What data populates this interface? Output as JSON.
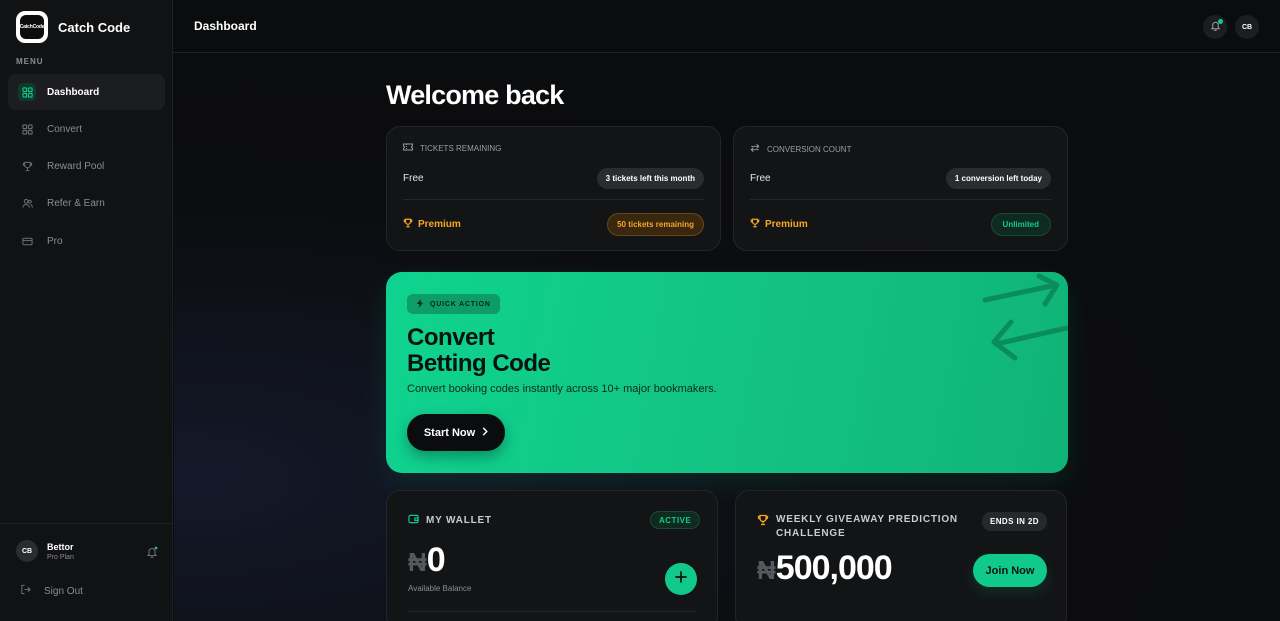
{
  "brand": {
    "name": "Catch Code",
    "logo_text": "CatchCode"
  },
  "sidebar": {
    "menu_label": "MENU",
    "items": [
      {
        "label": "Dashboard",
        "icon": "grid-icon",
        "active": true
      },
      {
        "label": "Convert",
        "icon": "grid-icon",
        "active": false
      },
      {
        "label": "Reward Pool",
        "icon": "trophy-icon",
        "active": false
      },
      {
        "label": "Refer & Earn",
        "icon": "users-icon",
        "active": false
      },
      {
        "label": "Pro",
        "icon": "card-icon",
        "active": false
      }
    ],
    "user": {
      "initials": "CB",
      "name": "Bettor",
      "plan": "Pro Plan"
    },
    "sign_out": "Sign Out"
  },
  "header": {
    "title": "Dashboard",
    "avatar_initials": "CB"
  },
  "main": {
    "welcome": "Welcome back",
    "tickets": {
      "title": "TICKETS REMAINING",
      "free_label": "Free",
      "free_value": "3 tickets left this month",
      "premium_label": "Premium",
      "premium_value": "50 tickets remaining"
    },
    "conversions": {
      "title": "CONVERSION COUNT",
      "free_label": "Free",
      "free_value": "1 conversion left today",
      "premium_label": "Premium",
      "premium_value": "Unlimited"
    },
    "hero": {
      "badge": "QUICK ACTION",
      "title_line1": "Convert",
      "title_line2": "Betting Code",
      "subtitle": "Convert booking codes instantly across 10+ major bookmakers.",
      "button": "Start Now"
    },
    "wallet": {
      "title": "MY WALLET",
      "status": "ACTIVE",
      "currency": "₦",
      "balance": "0",
      "balance_label": "Available Balance"
    },
    "giveaway": {
      "title": "WEEKLY GIVEAWAY PREDICTION CHALLENGE",
      "ends": "ENDS IN 2D",
      "currency": "₦",
      "prize": "500,000",
      "button": "Join Now"
    }
  },
  "colors": {
    "accent": "#12c98c",
    "premium": "#f5a623",
    "background": "#0b0c0d",
    "card": "#131416"
  }
}
